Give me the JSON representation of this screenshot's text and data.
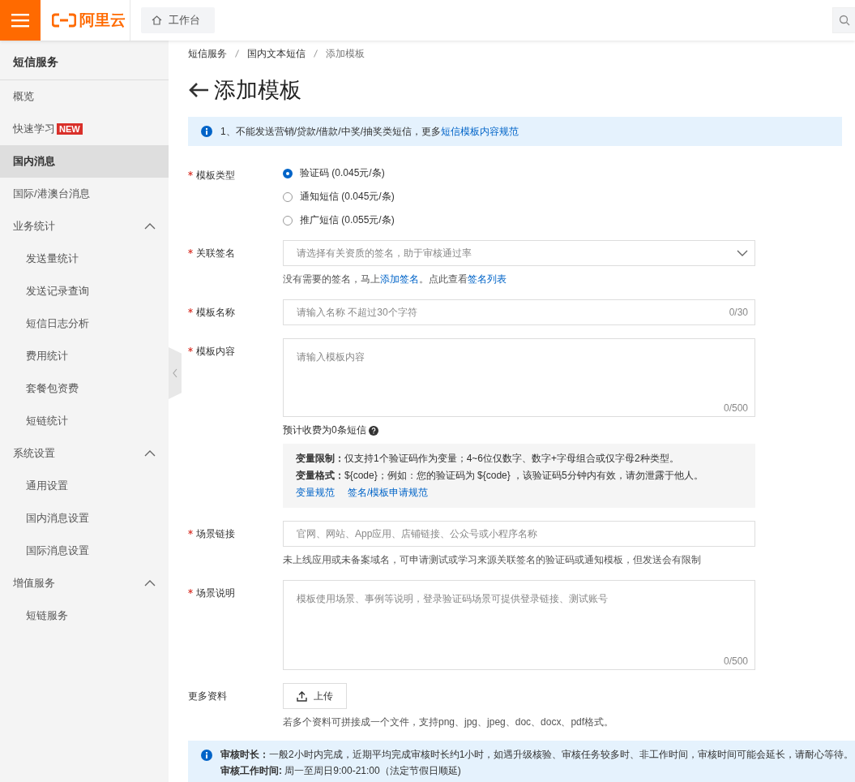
{
  "topbar": {
    "logo_text": "阿里云",
    "workbench": "工作台"
  },
  "sidebar": {
    "title": "短信服务",
    "items": [
      {
        "kind": "link",
        "label": "概览",
        "selected": false
      },
      {
        "kind": "link",
        "label": "快速学习",
        "badge": "NEW",
        "selected": false
      },
      {
        "kind": "link",
        "label": "国内消息",
        "selected": true
      },
      {
        "kind": "link",
        "label": "国际/港澳台消息",
        "selected": false
      },
      {
        "kind": "group",
        "label": "业务统计",
        "expanded": true,
        "children": [
          {
            "label": "发送量统计",
            "selected": false
          },
          {
            "label": "发送记录查询",
            "selected": false
          },
          {
            "label": "短信日志分析",
            "selected": false
          },
          {
            "label": "费用统计",
            "selected": false
          },
          {
            "label": "套餐包资费",
            "selected": false
          },
          {
            "label": "短链统计",
            "selected": false
          }
        ]
      },
      {
        "kind": "group",
        "label": "系统设置",
        "expanded": true,
        "children": [
          {
            "label": "通用设置",
            "selected": false
          },
          {
            "label": "国内消息设置",
            "selected": false
          },
          {
            "label": "国际消息设置",
            "selected": false
          }
        ]
      },
      {
        "kind": "group",
        "label": "增值服务",
        "expanded": true,
        "children": [
          {
            "label": "短链服务",
            "selected": false
          }
        ]
      }
    ]
  },
  "breadcrumb": [
    "短信服务",
    "国内文本短信",
    "添加模板"
  ],
  "page_title": "添加模板",
  "notice": {
    "text": "1、不能发送营销/贷款/借款/中奖/抽奖类短信，更多",
    "link": "短信模板内容规范"
  },
  "form": [
    {
      "kind": "radio",
      "label": "模板类型",
      "required": true,
      "options": [
        {
          "label": "验证码 (0.045元/条)",
          "selected": true
        },
        {
          "label": "通知短信 (0.045元/条)",
          "selected": false
        },
        {
          "label": "推广短信 (0.055元/条)",
          "selected": false
        }
      ]
    },
    {
      "kind": "select",
      "label": "关联签名",
      "required": true,
      "placeholder": "请选择有关资质的签名，助于审核通过率",
      "help": [
        {
          "text": "没有需要的签名，马上",
          "link": false
        },
        {
          "text": "添加签名",
          "link": true
        },
        {
          "text": "。点此查看",
          "link": false
        },
        {
          "text": "签名列表",
          "link": true
        }
      ]
    },
    {
      "kind": "input",
      "label": "模板名称",
      "required": true,
      "placeholder": "请输入名称 不超过30个字符",
      "counter": "0/30"
    },
    {
      "kind": "textarea",
      "label": "模板内容",
      "required": true,
      "placeholder": "请输入模板内容",
      "counter": "0/500",
      "estimate": "预计收费为0条短信",
      "tips": [
        "**变量限制：**仅支持1个验证码作为变量；4~6位仅数字、数字+字母组合或仅字母2种类型。",
        "**变量格式：**${code}；例如：您的验证码为 ${code} ，该验证码5分钟内有效，请勿泄露于他人。"
      ],
      "tip_links": [
        "变量规范",
        "签名/模板申请规范"
      ]
    },
    {
      "kind": "input",
      "label": "场景链接",
      "required": true,
      "placeholder": "官网、网站、App应用、店铺链接、公众号或小程序名称",
      "help": [
        {
          "text": "未上线应用或未备案域名，可申请测试或学习来源关联签名的验证码或通知模板，但发送会有限制",
          "link": false
        }
      ]
    },
    {
      "kind": "textarea",
      "label": "场景说明",
      "required": true,
      "placeholder": "模板使用场景、事例等说明，登录验证码场景可提供登录链接、测试账号",
      "counter": "0/500"
    },
    {
      "kind": "upload",
      "label": "更多资料",
      "required": false,
      "button": "上传",
      "help": [
        {
          "text": "若多个资料可拼接成一个文件，支持png、jpg、jpeg、doc、docx、pdf格式。",
          "link": false
        }
      ]
    }
  ],
  "review_notice": [
    "**审核时长：**一般2小时内完成，近期平均完成审核时长约1小时，如遇升级核验、审核任务较多时、非工作时间，审核时间可能会延长，请耐心等待。",
    "**审核工作时间:** 周一至周日9:00-21:00（法定节假日顺延)"
  ]
}
